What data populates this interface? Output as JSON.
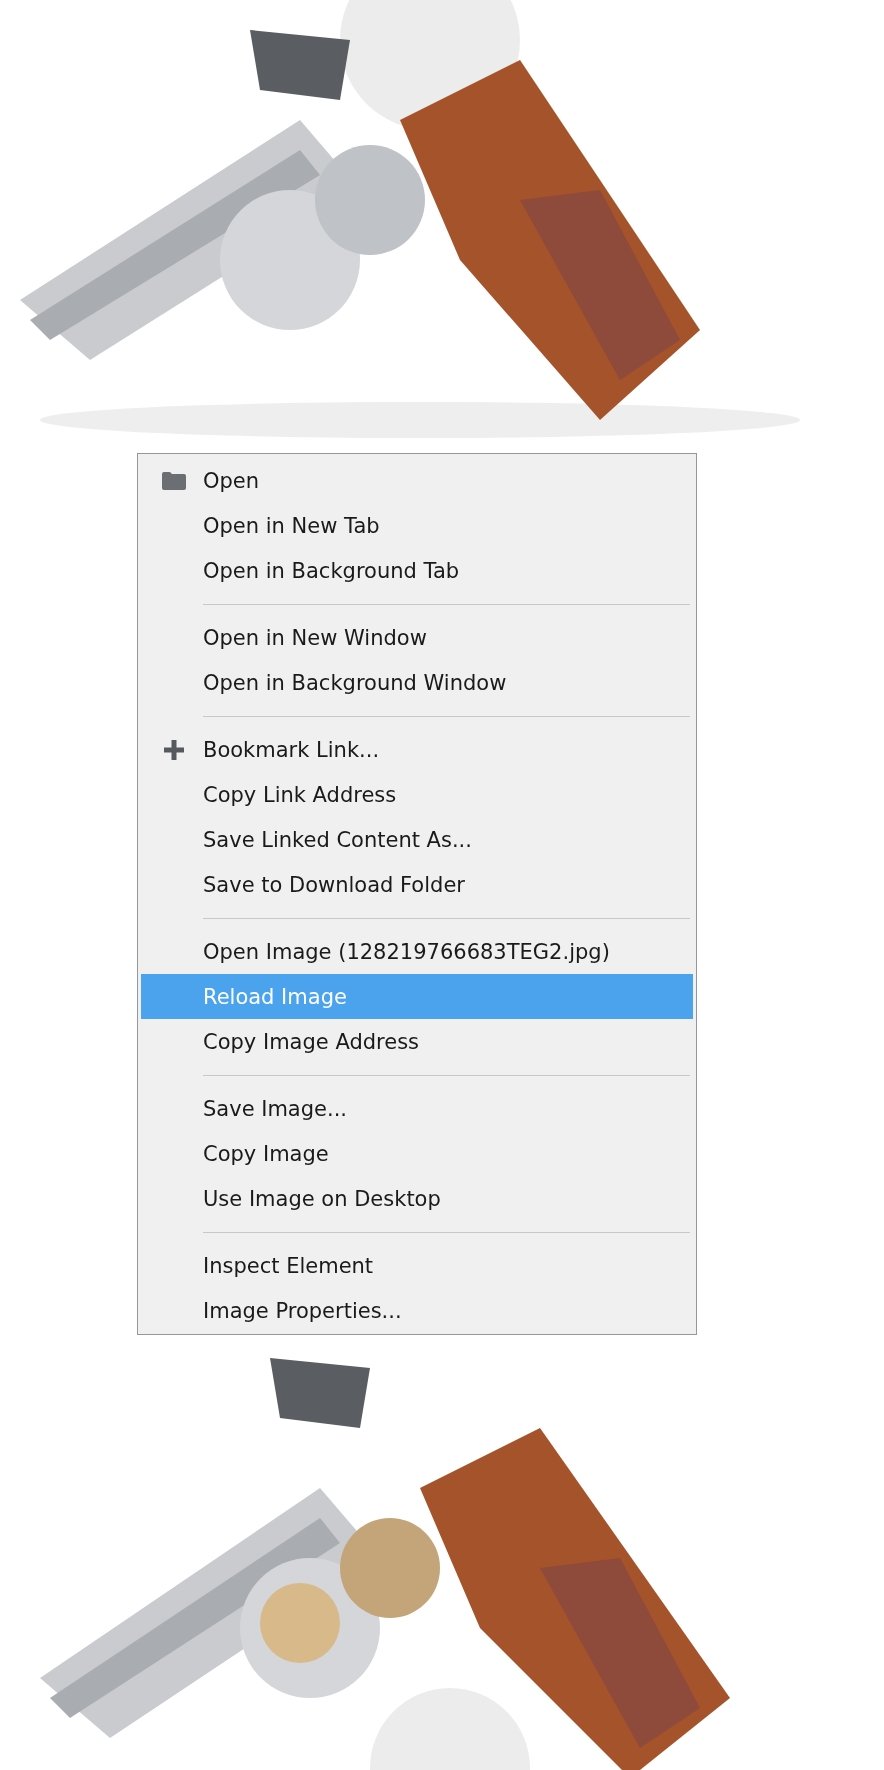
{
  "context_menu": {
    "items": [
      {
        "kind": "folder",
        "label": "Open",
        "selected": false
      },
      {
        "kind": "plain",
        "label": "Open in New Tab",
        "selected": false
      },
      {
        "kind": "plain",
        "label": "Open in Background Tab",
        "selected": false
      },
      {
        "kind": "separator"
      },
      {
        "kind": "plain",
        "label": "Open in New Window",
        "selected": false
      },
      {
        "kind": "plain",
        "label": "Open in Background Window",
        "selected": false
      },
      {
        "kind": "separator"
      },
      {
        "kind": "plus",
        "label": "Bookmark Link...",
        "selected": false
      },
      {
        "kind": "plain",
        "label": "Copy Link Address",
        "selected": false
      },
      {
        "kind": "plain",
        "label": "Save Linked Content As...",
        "selected": false
      },
      {
        "kind": "plain",
        "label": "Save to Download Folder",
        "selected": false
      },
      {
        "kind": "separator"
      },
      {
        "kind": "plain",
        "label": "Open Image (128219766683TEG2.jpg)",
        "selected": false
      },
      {
        "kind": "plain",
        "label": "Reload Image",
        "selected": true
      },
      {
        "kind": "plain",
        "label": "Copy Image Address",
        "selected": false
      },
      {
        "kind": "separator"
      },
      {
        "kind": "plain",
        "label": "Save Image...",
        "selected": false
      },
      {
        "kind": "plain",
        "label": "Copy Image",
        "selected": false
      },
      {
        "kind": "plain",
        "label": "Use Image on Desktop",
        "selected": false
      },
      {
        "kind": "separator"
      },
      {
        "kind": "plain",
        "label": "Inspect Element",
        "selected": false
      },
      {
        "kind": "plain",
        "label": "Image Properties...",
        "selected": false
      }
    ]
  }
}
